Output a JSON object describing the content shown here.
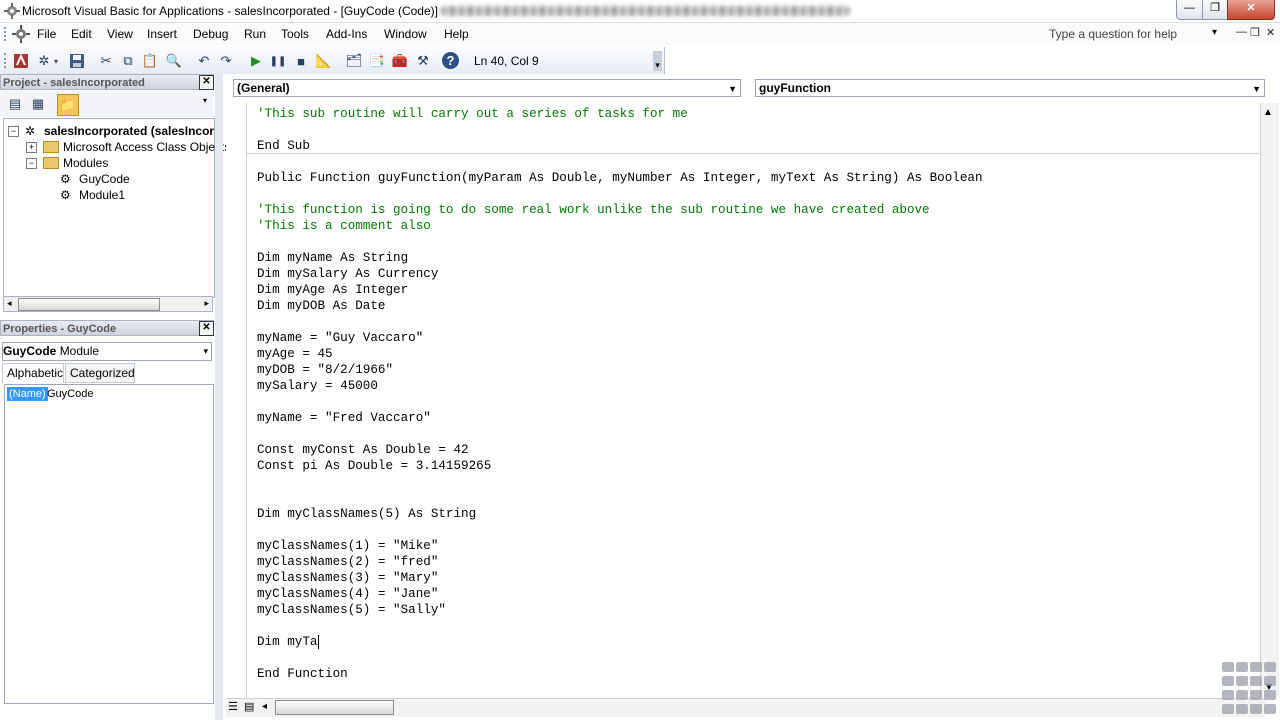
{
  "window": {
    "title": "Microsoft Visual Basic for Applications - salesIncorporated - [GuyCode (Code)]",
    "min_glyph": "—",
    "max_glyph": "❐",
    "close_glyph": "✕"
  },
  "menu": {
    "items": [
      "File",
      "Edit",
      "View",
      "Insert",
      "Debug",
      "Run",
      "Tools",
      "Add-Ins",
      "Window",
      "Help"
    ],
    "help_placeholder": "Type a question for help",
    "mdi_min": "—",
    "mdi_restore": "❐",
    "mdi_close": "✕"
  },
  "toolbar": {
    "position": "Ln 40, Col 9"
  },
  "project": {
    "title": "Project - salesIncorporated",
    "tree": {
      "root": "salesIncorporated (salesIncor",
      "access_objects": "Microsoft Access Class Objects",
      "modules": "Modules",
      "module_items": [
        "GuyCode",
        "Module1"
      ]
    }
  },
  "properties": {
    "title": "Properties - GuyCode",
    "object_name": "GuyCode",
    "object_type": "Module",
    "tabs": [
      "Alphabetic",
      "Categorized"
    ],
    "rows": [
      {
        "name": "(Name)",
        "value": "GuyCode"
      }
    ]
  },
  "code": {
    "object_combo": "(General)",
    "procedure_combo": "guyFunction",
    "lines": [
      "'This sub routine will carry out a series of tasks for me",
      "",
      "End Sub",
      "",
      "Public Function guyFunction(myParam As Double, myNumber As Integer, myText As String) As Boolean",
      "",
      "'This function is going to do some real work unlike the sub routine we have created above",
      "'This is a comment also",
      "",
      "Dim myName As String",
      "Dim mySalary As Currency",
      "Dim myAge As Integer",
      "Dim myDOB As Date",
      "",
      "myName = \"Guy Vaccaro\"",
      "myAge = 45",
      "myDOB = \"8/2/1966\"",
      "mySalary = 45000",
      "",
      "myName = \"Fred Vaccaro\"",
      "",
      "Const myConst As Double = 42",
      "Const pi As Double = 3.14159265",
      "",
      "",
      "Dim myClassNames(5) As String",
      "",
      "myClassNames(1) = \"Mike\"",
      "myClassNames(2) = \"fred\"",
      "myClassNames(3) = \"Mary\"",
      "myClassNames(4) = \"Jane\"",
      "myClassNames(5) = \"Sally\"",
      "",
      "Dim myTa",
      "",
      "End Function"
    ],
    "comment_lines": [
      0,
      6,
      7
    ],
    "caret_line": 33,
    "comment_color": "#007a00",
    "keyword_color": "#000066"
  }
}
